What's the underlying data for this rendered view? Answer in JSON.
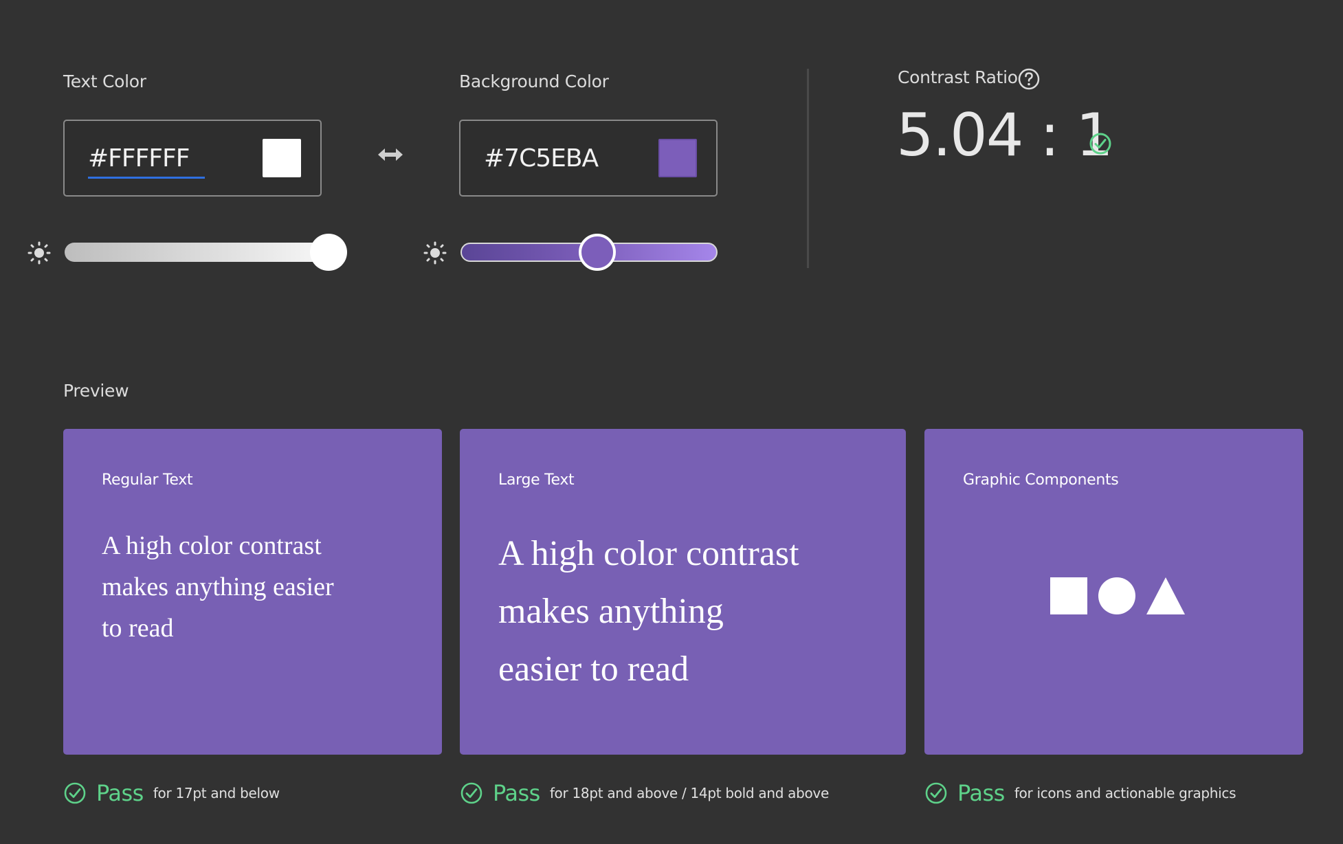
{
  "text_color": {
    "label": "Text Color",
    "value": "#FFFFFF",
    "swatch": "#FFFFFF",
    "brightness": 1.0
  },
  "background_color": {
    "label": "Background Color",
    "value": "#7C5EBA",
    "swatch": "#7C5EBA",
    "brightness": 0.5
  },
  "contrast": {
    "label": "Contrast Ratio",
    "help_icon": "question-circle-icon",
    "value": "5.04 : 1",
    "status_icon": "check-circle-icon"
  },
  "swap_icon": "swap-arrows-icon",
  "preview": {
    "label": "Preview",
    "card_color": "#7860B4",
    "regular": {
      "title": "Regular Text",
      "lines": [
        "A high color contrast",
        "makes anything easier",
        "to read"
      ]
    },
    "large": {
      "title": "Large Text",
      "lines": [
        "A high color contrast",
        "makes anything",
        "easier to read"
      ]
    },
    "graphic": {
      "title": "Graphic Components",
      "shapes": [
        "square-icon",
        "circle-icon",
        "triangle-icon"
      ]
    }
  },
  "results": [
    {
      "status": "Pass",
      "description": "for 17pt and below"
    },
    {
      "status": "Pass",
      "description": "for 18pt and above / 14pt bold and above"
    },
    {
      "status": "Pass",
      "description": "for icons and actionable graphics"
    }
  ],
  "colors": {
    "pass": "#5ED28A",
    "page_background": "#323232"
  }
}
